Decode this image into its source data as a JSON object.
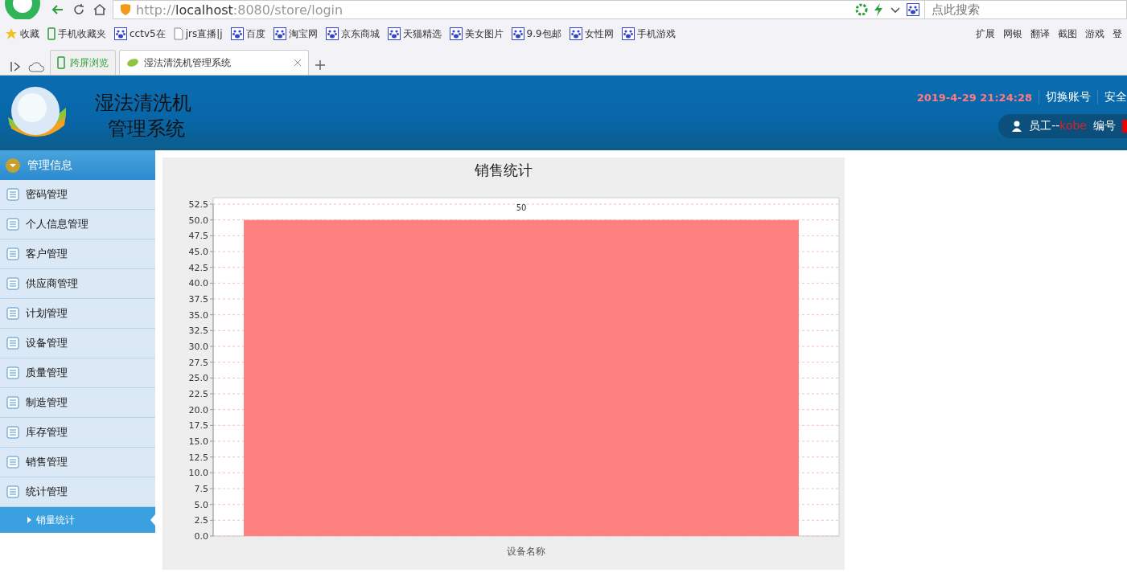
{
  "browser": {
    "url_scheme": "http://",
    "url_host": "localhost",
    "url_rest": ":8080/store/login",
    "search": {
      "placeholder": "点此搜索"
    },
    "bookmarks": [
      {
        "label": "收藏",
        "kind": "menu"
      },
      {
        "label": "手机收藏夹",
        "kind": "phone"
      },
      {
        "label": "cctv5在",
        "kind": "paw"
      },
      {
        "label": "jrs直播|j",
        "kind": "page"
      },
      {
        "label": "百度",
        "kind": "paw"
      },
      {
        "label": "淘宝网",
        "kind": "paw"
      },
      {
        "label": "京东商城",
        "kind": "paw"
      },
      {
        "label": "天猫精选",
        "kind": "paw"
      },
      {
        "label": "美女图片",
        "kind": "paw"
      },
      {
        "label": "9.9包邮",
        "kind": "paw"
      },
      {
        "label": "女性网",
        "kind": "paw"
      },
      {
        "label": "手机游戏",
        "kind": "paw"
      }
    ],
    "tools": [
      "扩展",
      "网银",
      "翻译",
      "截图",
      "游戏",
      "登"
    ],
    "tabs": [
      {
        "label": "跨屏浏览",
        "selected": false
      },
      {
        "label": "湿法清洗机管理系统",
        "selected": true
      }
    ]
  },
  "header": {
    "title_lines": [
      "湿法清洗机",
      "管理系统"
    ],
    "datetime": "2019-4-29 21:24:28",
    "links": [
      "切换账号",
      "安全"
    ],
    "user_prefix": "员工--",
    "user_name": "kobe",
    "id_label": "编号"
  },
  "sidebar": {
    "title": "管理信息",
    "items": [
      {
        "label": "密码管理"
      },
      {
        "label": "个人信息管理"
      },
      {
        "label": "客户管理"
      },
      {
        "label": "供应商管理"
      },
      {
        "label": "计划管理"
      },
      {
        "label": "设备管理"
      },
      {
        "label": "质量管理"
      },
      {
        "label": "制造管理"
      },
      {
        "label": "库存管理"
      },
      {
        "label": "销售管理"
      },
      {
        "label": "统计管理",
        "children": [
          {
            "label": "销量统计",
            "selected": true
          }
        ]
      }
    ]
  },
  "chart_data": {
    "type": "bar",
    "title": "销售统计",
    "xlabel": "设备名称",
    "series": [
      {
        "color": "#ff8080",
        "values": [
          50
        ]
      }
    ],
    "ylim": [
      0,
      52.5
    ],
    "grid": true,
    "yticks": [
      {
        "value": 0,
        "label": "0.0"
      },
      2.5,
      {
        "value": 5,
        "label": "5.0"
      },
      7.5,
      {
        "value": 10,
        "label": "10.0"
      },
      12.5,
      {
        "value": 15,
        "label": "15.0"
      },
      17.5,
      {
        "value": 20,
        "label": "20.0"
      },
      22.5,
      {
        "value": 25,
        "label": "25.0"
      },
      27.5,
      {
        "value": 30,
        "label": "30.0"
      },
      32.5,
      {
        "value": 35,
        "label": "35.0"
      },
      37.5,
      {
        "value": 40,
        "label": "40.0"
      },
      42.5,
      {
        "value": 45,
        "label": "45.0"
      },
      47.5,
      {
        "value": 50,
        "label": "50.0"
      },
      52.5
    ],
    "data_labels": true
  }
}
